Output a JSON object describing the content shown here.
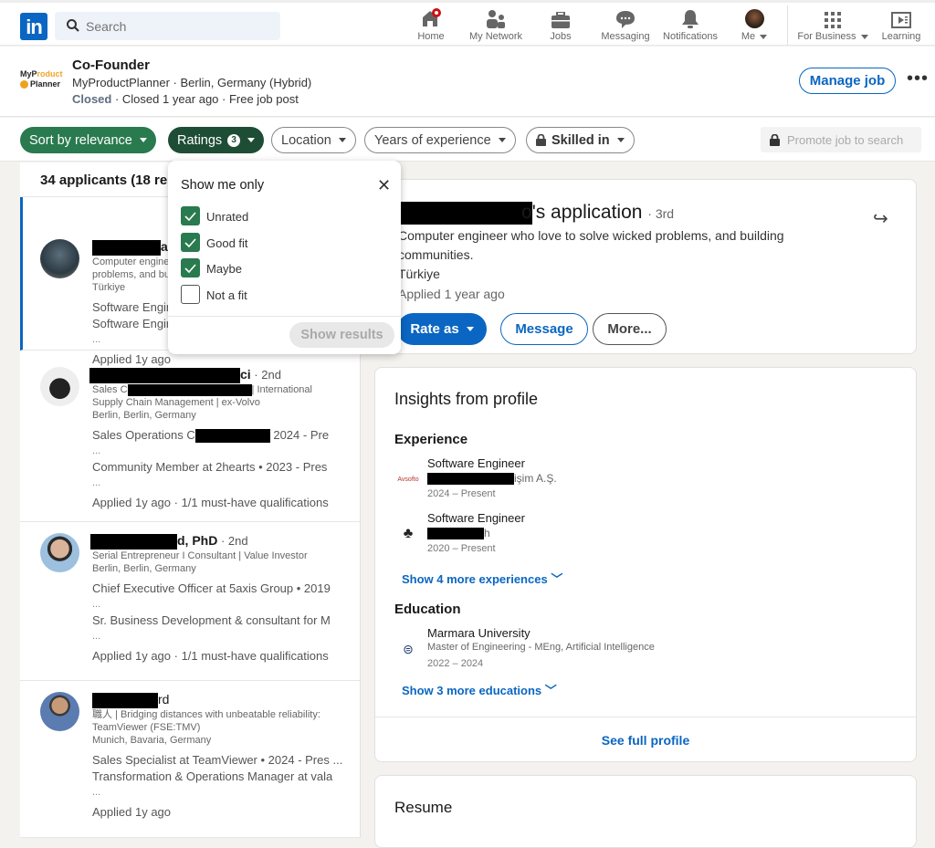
{
  "nav": {
    "logo": "in",
    "search_placeholder": "Search",
    "items": [
      {
        "label": "Home",
        "icon": "home-icon",
        "notification": true
      },
      {
        "label": "My Network",
        "icon": "network-icon"
      },
      {
        "label": "Jobs",
        "icon": "briefcase-icon"
      },
      {
        "label": "Messaging",
        "icon": "messaging-icon"
      },
      {
        "label": "Notifications",
        "icon": "bell-icon"
      },
      {
        "label": "Me",
        "icon": "avatar"
      },
      {
        "label": "For Business",
        "icon": "grid-icon"
      },
      {
        "label": "Learning",
        "icon": "learning-icon"
      }
    ]
  },
  "job": {
    "company_logo_line1": "MyProduct",
    "company_logo_line2": "Planner",
    "title": "Co-Founder",
    "subtitle": "MyProductPlanner · Berlin, Germany (Hybrid)",
    "status": "Closed",
    "status_rest": " · Closed 1 year ago · Free job post",
    "manage_label": "Manage job",
    "more_label": "•••"
  },
  "filters": {
    "sort": "Sort by relevance",
    "ratings": "Ratings",
    "ratings_count": "3",
    "location": "Location",
    "years": "Years of experience",
    "skilled": "Skilled in",
    "promote": "Promote job to search"
  },
  "popup": {
    "title": "Show me only",
    "options": [
      {
        "label": "Unrated",
        "checked": true
      },
      {
        "label": "Good fit",
        "checked": true
      },
      {
        "label": "Maybe",
        "checked": true
      },
      {
        "label": "Not a fit",
        "checked": false
      }
    ],
    "show_results": "Show results"
  },
  "applicants": {
    "header": "34 applicants (18 results)",
    "list": [
      {
        "name_suffix": "a",
        "degree": "",
        "headline1": "Computer engineer who love to solve wicked",
        "headline2": "problems, and building communities.",
        "location": "Türkiye",
        "exp1": "Software Engineer",
        "exp2": "Software Engineer",
        "exp_more": "...",
        "applied": "Applied 1y ago"
      },
      {
        "name_suffix": "ci",
        "degree": " · 2nd",
        "headline1_prefix": "Sales C",
        "headline1_suffix": "| International",
        "headline2": "Supply Chain Management | ex-Volvo",
        "location": "Berlin, Berlin, Germany",
        "exp1_prefix": "Sales Operations C",
        "exp1_suffix": " 2024 - Pre",
        "exp1_more": "...",
        "exp2": "Community Member at 2hearts • 2023 - Pres",
        "exp2_more": "...",
        "applied": "Applied 1y ago · 1/1 must-have qualifications"
      },
      {
        "name_suffix": "d, PhD",
        "degree": " · 2nd",
        "headline1": "Serial Entrepreneur I Consultant | Value Investor",
        "location": "Berlin, Berlin, Germany",
        "exp1": "Chief Executive Officer at 5axis Group • 2019",
        "exp1_more": "...",
        "exp2": "Sr. Business Development & consultant for M",
        "exp2_more": "...",
        "applied": "Applied 1y ago · 1/1 must-have qualifications"
      },
      {
        "name_suffix": "rd",
        "degree": "",
        "headline1": "職人 | Bridging distances with unbeatable reliability:",
        "headline2": "TeamViewer (FSE:TMV)",
        "location": "Munich, Bavaria, Germany",
        "exp1": "Sales Specialist at TeamViewer • 2024 - Pres ...",
        "exp2": "Transformation & Operations Manager at vala",
        "exp2_more": "...",
        "applied": "Applied 1y ago"
      }
    ]
  },
  "application": {
    "title_prefix": "A",
    "title_suffix": "o's application",
    "degree": "· 3rd",
    "headline1": "Computer engineer who love to solve wicked problems, and building",
    "headline2": "communities.",
    "location": "Türkiye",
    "applied": "Applied 1 year ago",
    "rate_label": "Rate as",
    "message_label": "Message",
    "more_label": "More..."
  },
  "insights": {
    "title": "Insights from profile",
    "experience_heading": "Experience",
    "experiences": [
      {
        "title": "Software Engineer",
        "company_suffix": "işim A.Ş.",
        "dates": "2024 – Present"
      },
      {
        "title": "Software Engineer",
        "company_suffix": "h",
        "dates": "2020 – Present"
      }
    ],
    "show_more_exp": "Show 4 more experiences",
    "education_heading": "Education",
    "education": {
      "school": "Marmara University",
      "degree": "Master of Engineering - MEng, Artificial Intelligence",
      "dates": "2022 – 2024"
    },
    "show_more_edu": "Show 3 more educations",
    "see_full": "See full profile"
  },
  "resume": {
    "title": "Resume"
  },
  "colors": {
    "brand": "#0a66c2",
    "green": "#2a7a4f",
    "dark_green": "#1e4d36",
    "notification": "#cc1016"
  }
}
